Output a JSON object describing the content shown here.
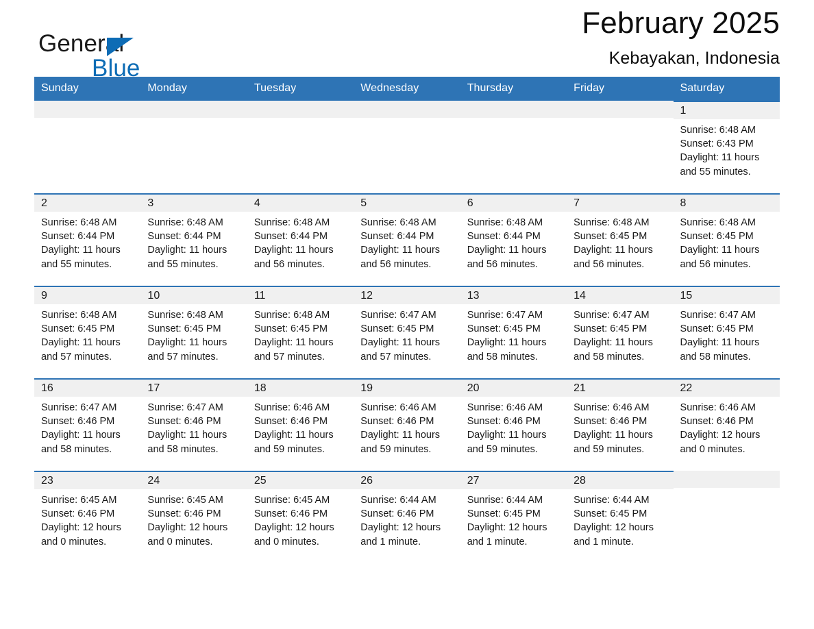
{
  "brand": {
    "name_part1": "General",
    "name_part2": "Blue",
    "logo_icon": "triangle-flag-icon",
    "accent_color": "#0d6cb5"
  },
  "header": {
    "title": "February 2025",
    "location": "Kebayakan, Indonesia"
  },
  "theme": {
    "header_blue": "#2e74b5",
    "row_band_gray": "#f0f0f0",
    "text_color": "#1a1a1a"
  },
  "weekdays": [
    "Sunday",
    "Monday",
    "Tuesday",
    "Wednesday",
    "Thursday",
    "Friday",
    "Saturday"
  ],
  "weeks": [
    [
      {
        "day": "",
        "sunrise": "",
        "sunset": "",
        "daylight": "",
        "blank": true
      },
      {
        "day": "",
        "sunrise": "",
        "sunset": "",
        "daylight": "",
        "blank": true
      },
      {
        "day": "",
        "sunrise": "",
        "sunset": "",
        "daylight": "",
        "blank": true
      },
      {
        "day": "",
        "sunrise": "",
        "sunset": "",
        "daylight": "",
        "blank": true
      },
      {
        "day": "",
        "sunrise": "",
        "sunset": "",
        "daylight": "",
        "blank": true
      },
      {
        "day": "",
        "sunrise": "",
        "sunset": "",
        "daylight": "",
        "blank": true
      },
      {
        "day": "1",
        "sunrise": "Sunrise: 6:48 AM",
        "sunset": "Sunset: 6:43 PM",
        "daylight": "Daylight: 11 hours and 55 minutes.",
        "blank": false
      }
    ],
    [
      {
        "day": "2",
        "sunrise": "Sunrise: 6:48 AM",
        "sunset": "Sunset: 6:44 PM",
        "daylight": "Daylight: 11 hours and 55 minutes.",
        "blank": false
      },
      {
        "day": "3",
        "sunrise": "Sunrise: 6:48 AM",
        "sunset": "Sunset: 6:44 PM",
        "daylight": "Daylight: 11 hours and 55 minutes.",
        "blank": false
      },
      {
        "day": "4",
        "sunrise": "Sunrise: 6:48 AM",
        "sunset": "Sunset: 6:44 PM",
        "daylight": "Daylight: 11 hours and 56 minutes.",
        "blank": false
      },
      {
        "day": "5",
        "sunrise": "Sunrise: 6:48 AM",
        "sunset": "Sunset: 6:44 PM",
        "daylight": "Daylight: 11 hours and 56 minutes.",
        "blank": false
      },
      {
        "day": "6",
        "sunrise": "Sunrise: 6:48 AM",
        "sunset": "Sunset: 6:44 PM",
        "daylight": "Daylight: 11 hours and 56 minutes.",
        "blank": false
      },
      {
        "day": "7",
        "sunrise": "Sunrise: 6:48 AM",
        "sunset": "Sunset: 6:45 PM",
        "daylight": "Daylight: 11 hours and 56 minutes.",
        "blank": false
      },
      {
        "day": "8",
        "sunrise": "Sunrise: 6:48 AM",
        "sunset": "Sunset: 6:45 PM",
        "daylight": "Daylight: 11 hours and 56 minutes.",
        "blank": false
      }
    ],
    [
      {
        "day": "9",
        "sunrise": "Sunrise: 6:48 AM",
        "sunset": "Sunset: 6:45 PM",
        "daylight": "Daylight: 11 hours and 57 minutes.",
        "blank": false
      },
      {
        "day": "10",
        "sunrise": "Sunrise: 6:48 AM",
        "sunset": "Sunset: 6:45 PM",
        "daylight": "Daylight: 11 hours and 57 minutes.",
        "blank": false
      },
      {
        "day": "11",
        "sunrise": "Sunrise: 6:48 AM",
        "sunset": "Sunset: 6:45 PM",
        "daylight": "Daylight: 11 hours and 57 minutes.",
        "blank": false
      },
      {
        "day": "12",
        "sunrise": "Sunrise: 6:47 AM",
        "sunset": "Sunset: 6:45 PM",
        "daylight": "Daylight: 11 hours and 57 minutes.",
        "blank": false
      },
      {
        "day": "13",
        "sunrise": "Sunrise: 6:47 AM",
        "sunset": "Sunset: 6:45 PM",
        "daylight": "Daylight: 11 hours and 58 minutes.",
        "blank": false
      },
      {
        "day": "14",
        "sunrise": "Sunrise: 6:47 AM",
        "sunset": "Sunset: 6:45 PM",
        "daylight": "Daylight: 11 hours and 58 minutes.",
        "blank": false
      },
      {
        "day": "15",
        "sunrise": "Sunrise: 6:47 AM",
        "sunset": "Sunset: 6:45 PM",
        "daylight": "Daylight: 11 hours and 58 minutes.",
        "blank": false
      }
    ],
    [
      {
        "day": "16",
        "sunrise": "Sunrise: 6:47 AM",
        "sunset": "Sunset: 6:46 PM",
        "daylight": "Daylight: 11 hours and 58 minutes.",
        "blank": false
      },
      {
        "day": "17",
        "sunrise": "Sunrise: 6:47 AM",
        "sunset": "Sunset: 6:46 PM",
        "daylight": "Daylight: 11 hours and 58 minutes.",
        "blank": false
      },
      {
        "day": "18",
        "sunrise": "Sunrise: 6:46 AM",
        "sunset": "Sunset: 6:46 PM",
        "daylight": "Daylight: 11 hours and 59 minutes.",
        "blank": false
      },
      {
        "day": "19",
        "sunrise": "Sunrise: 6:46 AM",
        "sunset": "Sunset: 6:46 PM",
        "daylight": "Daylight: 11 hours and 59 minutes.",
        "blank": false
      },
      {
        "day": "20",
        "sunrise": "Sunrise: 6:46 AM",
        "sunset": "Sunset: 6:46 PM",
        "daylight": "Daylight: 11 hours and 59 minutes.",
        "blank": false
      },
      {
        "day": "21",
        "sunrise": "Sunrise: 6:46 AM",
        "sunset": "Sunset: 6:46 PM",
        "daylight": "Daylight: 11 hours and 59 minutes.",
        "blank": false
      },
      {
        "day": "22",
        "sunrise": "Sunrise: 6:46 AM",
        "sunset": "Sunset: 6:46 PM",
        "daylight": "Daylight: 12 hours and 0 minutes.",
        "blank": false
      }
    ],
    [
      {
        "day": "23",
        "sunrise": "Sunrise: 6:45 AM",
        "sunset": "Sunset: 6:46 PM",
        "daylight": "Daylight: 12 hours and 0 minutes.",
        "blank": false
      },
      {
        "day": "24",
        "sunrise": "Sunrise: 6:45 AM",
        "sunset": "Sunset: 6:46 PM",
        "daylight": "Daylight: 12 hours and 0 minutes.",
        "blank": false
      },
      {
        "day": "25",
        "sunrise": "Sunrise: 6:45 AM",
        "sunset": "Sunset: 6:46 PM",
        "daylight": "Daylight: 12 hours and 0 minutes.",
        "blank": false
      },
      {
        "day": "26",
        "sunrise": "Sunrise: 6:44 AM",
        "sunset": "Sunset: 6:46 PM",
        "daylight": "Daylight: 12 hours and 1 minute.",
        "blank": false
      },
      {
        "day": "27",
        "sunrise": "Sunrise: 6:44 AM",
        "sunset": "Sunset: 6:45 PM",
        "daylight": "Daylight: 12 hours and 1 minute.",
        "blank": false
      },
      {
        "day": "28",
        "sunrise": "Sunrise: 6:44 AM",
        "sunset": "Sunset: 6:45 PM",
        "daylight": "Daylight: 12 hours and 1 minute.",
        "blank": false
      },
      {
        "day": "",
        "sunrise": "",
        "sunset": "",
        "daylight": "",
        "blank": true
      }
    ]
  ]
}
